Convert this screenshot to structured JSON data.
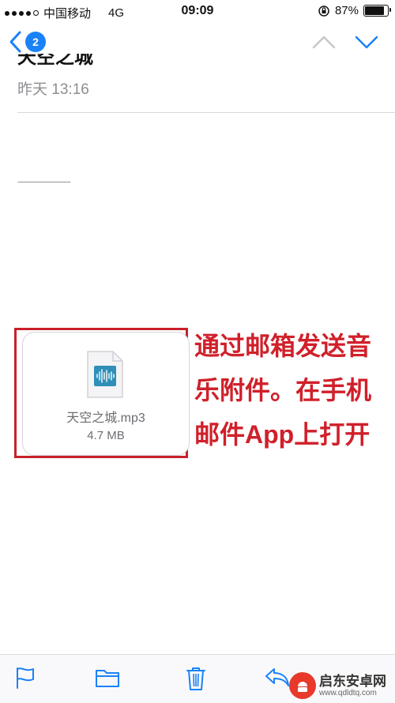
{
  "status_bar": {
    "carrier": "中国移动",
    "network": "4G",
    "time": "09:09",
    "battery_percent": "87%",
    "battery_level": 0.87
  },
  "nav": {
    "unread_count": "2"
  },
  "message": {
    "subject": "天空之城",
    "date": "昨天 13:16",
    "signature_line": "--------------------"
  },
  "attachment": {
    "file_name": "天空之城.mp3",
    "file_size": "4.7 MB"
  },
  "annotation": {
    "lines": [
      "通过邮箱发送音",
      "乐附件。在手机",
      "邮件App上打开"
    ]
  },
  "watermark": {
    "title": "启东安卓网",
    "url": "www.qdldtq.com"
  },
  "colors": {
    "accent": "#1a82f7",
    "annotation_red": "#d0202a"
  }
}
